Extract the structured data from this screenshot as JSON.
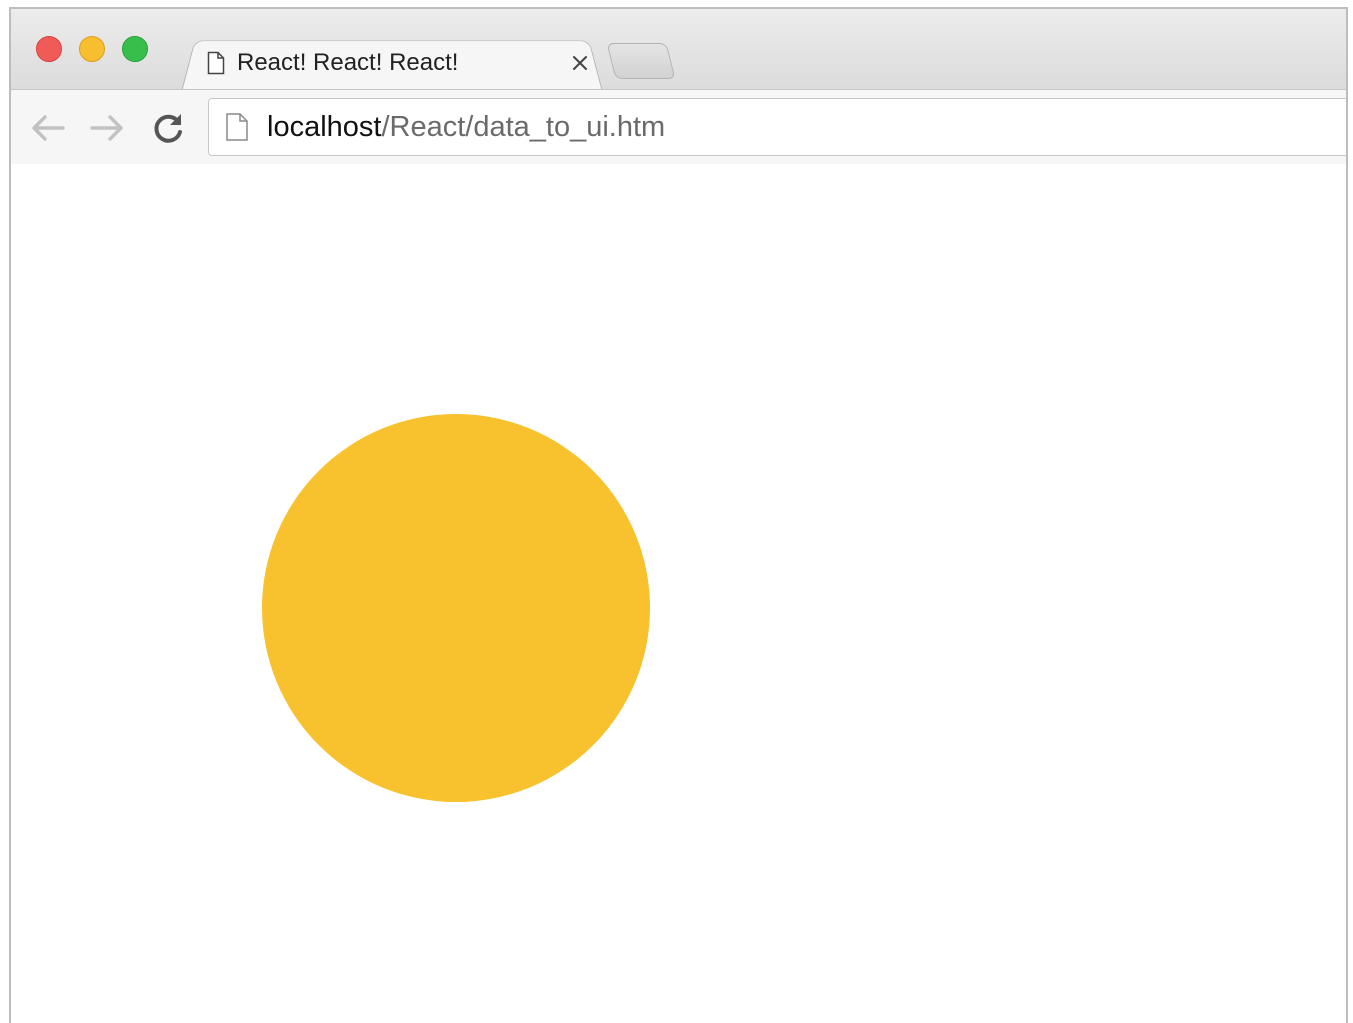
{
  "window": {
    "tab": {
      "title": "React! React! React!"
    },
    "address_bar": {
      "host": "localhost",
      "path": "/React/data_to_ui.htm"
    }
  },
  "icons": {
    "close": "close-window-icon",
    "minimize": "minimize-window-icon",
    "maximize": "maximize-window-icon",
    "tab_page": "page-icon",
    "tab_close": "close-icon",
    "back": "arrow-left-icon",
    "forward": "arrow-right-icon",
    "reload": "reload-icon"
  },
  "content": {
    "circle_color": "#F7C22E"
  },
  "colors": {
    "traffic_close": "#F05A57",
    "traffic_minimize": "#F7BE2F",
    "traffic_maximize": "#36BF4A"
  }
}
